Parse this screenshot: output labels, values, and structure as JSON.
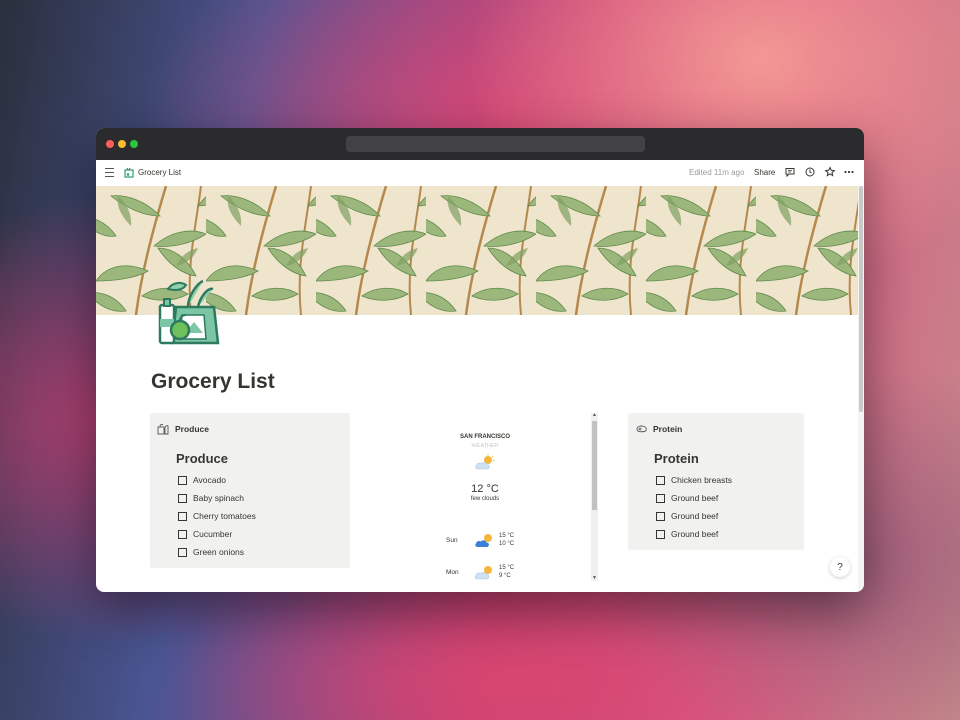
{
  "breadcrumb": {
    "title": "Grocery List",
    "icon": "grocery-bag-icon"
  },
  "topbar": {
    "edited": "Edited 11m ago",
    "share": "Share"
  },
  "page": {
    "title": "Grocery List"
  },
  "produce": {
    "header": "Produce",
    "heading": "Produce",
    "items": [
      "Avocado",
      "Baby spinach",
      "Cherry tomatoes",
      "Cucumber",
      "Green onions"
    ]
  },
  "protein": {
    "header": "Protein",
    "heading": "Protein",
    "items": [
      "Chicken breasts",
      "Ground beef",
      "Ground beef",
      "Ground beef"
    ]
  },
  "weather": {
    "city": "SAN FRANCISCO",
    "subtitle": "WEATHER",
    "temp": "12 °C",
    "desc": "few clouds",
    "forecast": [
      {
        "day": "Sun",
        "hi": "15 °C",
        "lo": "10 °C"
      },
      {
        "day": "Mon",
        "hi": "15 °C",
        "lo": "9 °C"
      }
    ]
  },
  "help": "?",
  "colors": {
    "accent": "#2f9e7a",
    "card_bg": "#f1f1ef",
    "text": "#37352f"
  }
}
